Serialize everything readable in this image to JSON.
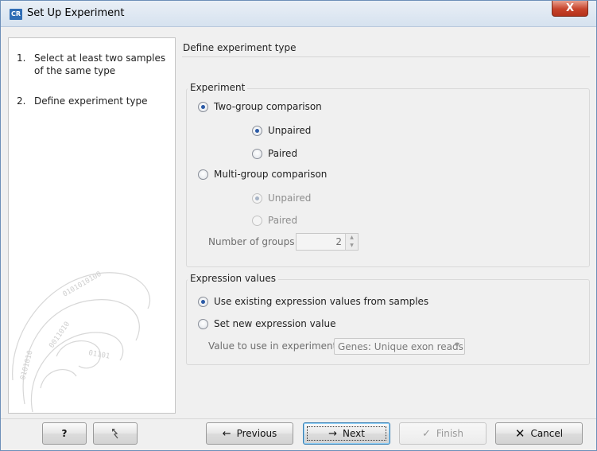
{
  "window": {
    "app_icon": "CR",
    "title": "Set Up Experiment",
    "close_glyph": "X"
  },
  "steps": [
    {
      "number": "1.",
      "text": "Select at least two samples of the same type"
    },
    {
      "number": "2.",
      "text": "Define experiment type"
    }
  ],
  "main": {
    "section_title": "Define experiment type",
    "experiment": {
      "label": "Experiment",
      "two_group": {
        "label": "Two-group comparison",
        "selected": true
      },
      "two_group_unpaired": {
        "label": "Unpaired",
        "selected": true
      },
      "two_group_paired": {
        "label": "Paired",
        "selected": false
      },
      "multi_group": {
        "label": "Multi-group comparison",
        "selected": false
      },
      "multi_group_unpaired": {
        "label": "Unpaired",
        "selected": true,
        "disabled": true
      },
      "multi_group_paired": {
        "label": "Paired",
        "selected": false,
        "disabled": true
      },
      "number_of_groups_label": "Number of groups",
      "number_of_groups_value": "2"
    },
    "expression": {
      "label": "Expression values",
      "use_existing": {
        "label": "Use existing expression values from samples",
        "selected": true
      },
      "set_new": {
        "label": "Set new expression value",
        "selected": false
      },
      "value_label": "Value to use in experiment",
      "value_selected": "Genes: Unique exon reads"
    }
  },
  "buttons": {
    "help": "?",
    "reset_icon": "reset-icon",
    "previous": "Previous",
    "next": "Next",
    "finish": "Finish",
    "cancel": "Cancel"
  }
}
